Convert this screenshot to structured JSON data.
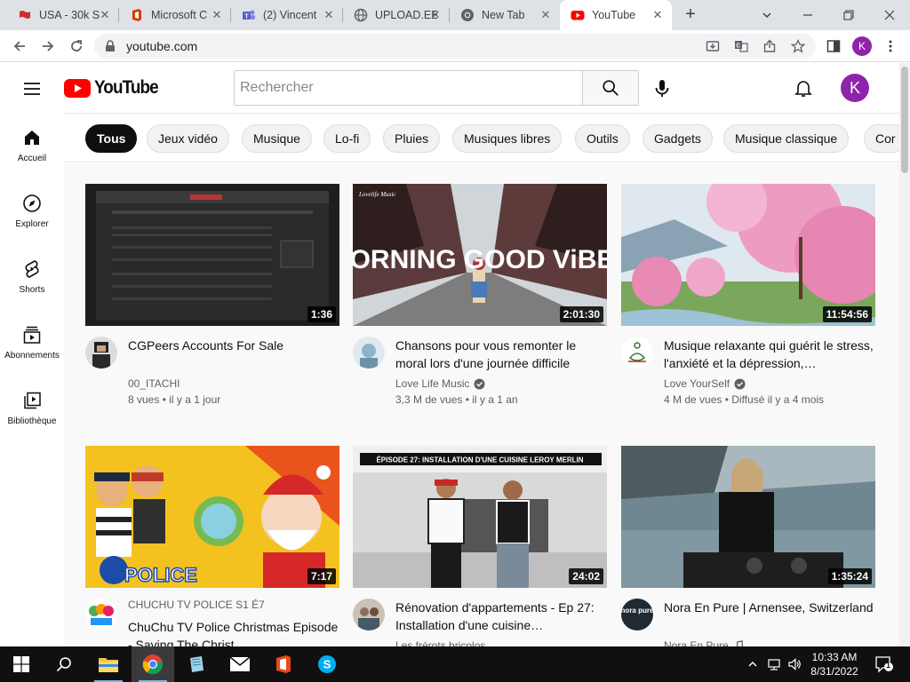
{
  "browser": {
    "tabs": [
      {
        "label": "USA - 30k S",
        "icon": "flag-icon",
        "color": "#cc2e2e"
      },
      {
        "label": "Microsoft C",
        "icon": "office-icon",
        "color": "#d83b01"
      },
      {
        "label": "(2) Vincent",
        "icon": "teams-icon",
        "color": "#5b5fc7"
      },
      {
        "label": "UPLOAD.EE",
        "icon": "globe-icon",
        "color": "#5f6368"
      },
      {
        "label": "New Tab",
        "icon": "chrome-icon",
        "color": "#5f6368"
      },
      {
        "label": "YouTube",
        "icon": "youtube-icon",
        "color": "#ff0000"
      }
    ],
    "url": "youtube.com",
    "profile_initial": "K"
  },
  "youtube": {
    "logo_text": "YouTube",
    "logo_color": "#ff0000",
    "search_placeholder": "Rechercher",
    "avatar_initial": "K",
    "avatar_color": "#8e24aa",
    "guide": [
      {
        "label": "Accueil",
        "icon": "home-icon"
      },
      {
        "label": "Explorer",
        "icon": "compass-icon"
      },
      {
        "label": "Shorts",
        "icon": "shorts-icon"
      },
      {
        "label": "Abonnements",
        "icon": "subscriptions-icon"
      },
      {
        "label": "Bibliothèque",
        "icon": "library-icon"
      }
    ],
    "chips": [
      "Tous",
      "Jeux vidéo",
      "Musique",
      "Lo-fi",
      "Pluies",
      "Musiques libres",
      "Outils",
      "Gadgets",
      "Musique classique",
      "Cor"
    ],
    "videos": [
      {
        "title": "CGPeers Accounts For Sale",
        "channel": "00_ITACHI",
        "verified": false,
        "stats": "8 vues • il y a 1 jour",
        "duration": "1:36"
      },
      {
        "title": "Chansons pour vous remonter le moral lors d'une journée difficile",
        "channel": "Love Life Music",
        "verified": true,
        "stats": "3,3 M de vues • il y a 1 an",
        "duration": "2:01:30",
        "thumb_text": "MORNING GOOD ViBES",
        "thumb_logo": "Lovelife Music"
      },
      {
        "title": "Musique relaxante qui guérit le stress, l'anxiété et la dépression,…",
        "channel": "Love YourSelf",
        "verified": true,
        "stats": "4 M de vues • Diffusé il y a 4 mois",
        "duration": "11:54:56"
      },
      {
        "title": "ChuChu TV Police Christmas Episode - Saving The Christ…",
        "channel": "CHUCHU TV POLICE  S1 É7",
        "verified": false,
        "stats": "",
        "duration": "7:17",
        "thumb_text": "POLICE"
      },
      {
        "title": "Rénovation d'appartements - Ep 27: Installation d'une cuisine…",
        "channel": "Les frérots bricolos",
        "verified": false,
        "stats": "",
        "duration": "24:02",
        "thumb_text": "ÉPISODE 27: INSTALLATION D'UNE CUISINE LEROY MERLIN"
      },
      {
        "title": "Nora En Pure | Arnensee, Switzerland",
        "channel": "Nora En Pure",
        "verified": true,
        "stats": "",
        "duration": "1:35:24",
        "avatar_text": "nora pure"
      }
    ]
  },
  "taskbar": {
    "time": "10:33 AM",
    "date": "8/31/2022",
    "notifications": "1"
  }
}
